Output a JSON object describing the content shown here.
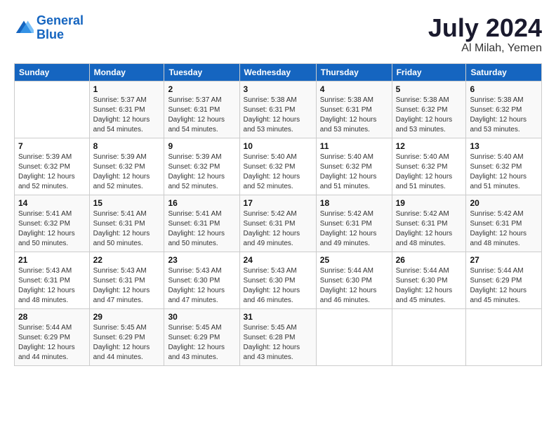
{
  "logo": {
    "line1": "General",
    "line2": "Blue"
  },
  "title": "July 2024",
  "subtitle": "Al Milah, Yemen",
  "days_header": [
    "Sunday",
    "Monday",
    "Tuesday",
    "Wednesday",
    "Thursday",
    "Friday",
    "Saturday"
  ],
  "weeks": [
    [
      {
        "day": "",
        "sunrise": "",
        "sunset": "",
        "daylight": ""
      },
      {
        "day": "1",
        "sunrise": "Sunrise: 5:37 AM",
        "sunset": "Sunset: 6:31 PM",
        "daylight": "Daylight: 12 hours and 54 minutes."
      },
      {
        "day": "2",
        "sunrise": "Sunrise: 5:37 AM",
        "sunset": "Sunset: 6:31 PM",
        "daylight": "Daylight: 12 hours and 54 minutes."
      },
      {
        "day": "3",
        "sunrise": "Sunrise: 5:38 AM",
        "sunset": "Sunset: 6:31 PM",
        "daylight": "Daylight: 12 hours and 53 minutes."
      },
      {
        "day": "4",
        "sunrise": "Sunrise: 5:38 AM",
        "sunset": "Sunset: 6:31 PM",
        "daylight": "Daylight: 12 hours and 53 minutes."
      },
      {
        "day": "5",
        "sunrise": "Sunrise: 5:38 AM",
        "sunset": "Sunset: 6:32 PM",
        "daylight": "Daylight: 12 hours and 53 minutes."
      },
      {
        "day": "6",
        "sunrise": "Sunrise: 5:38 AM",
        "sunset": "Sunset: 6:32 PM",
        "daylight": "Daylight: 12 hours and 53 minutes."
      }
    ],
    [
      {
        "day": "7",
        "sunrise": "Sunrise: 5:39 AM",
        "sunset": "Sunset: 6:32 PM",
        "daylight": "Daylight: 12 hours and 52 minutes."
      },
      {
        "day": "8",
        "sunrise": "Sunrise: 5:39 AM",
        "sunset": "Sunset: 6:32 PM",
        "daylight": "Daylight: 12 hours and 52 minutes."
      },
      {
        "day": "9",
        "sunrise": "Sunrise: 5:39 AM",
        "sunset": "Sunset: 6:32 PM",
        "daylight": "Daylight: 12 hours and 52 minutes."
      },
      {
        "day": "10",
        "sunrise": "Sunrise: 5:40 AM",
        "sunset": "Sunset: 6:32 PM",
        "daylight": "Daylight: 12 hours and 52 minutes."
      },
      {
        "day": "11",
        "sunrise": "Sunrise: 5:40 AM",
        "sunset": "Sunset: 6:32 PM",
        "daylight": "Daylight: 12 hours and 51 minutes."
      },
      {
        "day": "12",
        "sunrise": "Sunrise: 5:40 AM",
        "sunset": "Sunset: 6:32 PM",
        "daylight": "Daylight: 12 hours and 51 minutes."
      },
      {
        "day": "13",
        "sunrise": "Sunrise: 5:40 AM",
        "sunset": "Sunset: 6:32 PM",
        "daylight": "Daylight: 12 hours and 51 minutes."
      }
    ],
    [
      {
        "day": "14",
        "sunrise": "Sunrise: 5:41 AM",
        "sunset": "Sunset: 6:32 PM",
        "daylight": "Daylight: 12 hours and 50 minutes."
      },
      {
        "day": "15",
        "sunrise": "Sunrise: 5:41 AM",
        "sunset": "Sunset: 6:31 PM",
        "daylight": "Daylight: 12 hours and 50 minutes."
      },
      {
        "day": "16",
        "sunrise": "Sunrise: 5:41 AM",
        "sunset": "Sunset: 6:31 PM",
        "daylight": "Daylight: 12 hours and 50 minutes."
      },
      {
        "day": "17",
        "sunrise": "Sunrise: 5:42 AM",
        "sunset": "Sunset: 6:31 PM",
        "daylight": "Daylight: 12 hours and 49 minutes."
      },
      {
        "day": "18",
        "sunrise": "Sunrise: 5:42 AM",
        "sunset": "Sunset: 6:31 PM",
        "daylight": "Daylight: 12 hours and 49 minutes."
      },
      {
        "day": "19",
        "sunrise": "Sunrise: 5:42 AM",
        "sunset": "Sunset: 6:31 PM",
        "daylight": "Daylight: 12 hours and 48 minutes."
      },
      {
        "day": "20",
        "sunrise": "Sunrise: 5:42 AM",
        "sunset": "Sunset: 6:31 PM",
        "daylight": "Daylight: 12 hours and 48 minutes."
      }
    ],
    [
      {
        "day": "21",
        "sunrise": "Sunrise: 5:43 AM",
        "sunset": "Sunset: 6:31 PM",
        "daylight": "Daylight: 12 hours and 48 minutes."
      },
      {
        "day": "22",
        "sunrise": "Sunrise: 5:43 AM",
        "sunset": "Sunset: 6:31 PM",
        "daylight": "Daylight: 12 hours and 47 minutes."
      },
      {
        "day": "23",
        "sunrise": "Sunrise: 5:43 AM",
        "sunset": "Sunset: 6:30 PM",
        "daylight": "Daylight: 12 hours and 47 minutes."
      },
      {
        "day": "24",
        "sunrise": "Sunrise: 5:43 AM",
        "sunset": "Sunset: 6:30 PM",
        "daylight": "Daylight: 12 hours and 46 minutes."
      },
      {
        "day": "25",
        "sunrise": "Sunrise: 5:44 AM",
        "sunset": "Sunset: 6:30 PM",
        "daylight": "Daylight: 12 hours and 46 minutes."
      },
      {
        "day": "26",
        "sunrise": "Sunrise: 5:44 AM",
        "sunset": "Sunset: 6:30 PM",
        "daylight": "Daylight: 12 hours and 45 minutes."
      },
      {
        "day": "27",
        "sunrise": "Sunrise: 5:44 AM",
        "sunset": "Sunset: 6:29 PM",
        "daylight": "Daylight: 12 hours and 45 minutes."
      }
    ],
    [
      {
        "day": "28",
        "sunrise": "Sunrise: 5:44 AM",
        "sunset": "Sunset: 6:29 PM",
        "daylight": "Daylight: 12 hours and 44 minutes."
      },
      {
        "day": "29",
        "sunrise": "Sunrise: 5:45 AM",
        "sunset": "Sunset: 6:29 PM",
        "daylight": "Daylight: 12 hours and 44 minutes."
      },
      {
        "day": "30",
        "sunrise": "Sunrise: 5:45 AM",
        "sunset": "Sunset: 6:29 PM",
        "daylight": "Daylight: 12 hours and 43 minutes."
      },
      {
        "day": "31",
        "sunrise": "Sunrise: 5:45 AM",
        "sunset": "Sunset: 6:28 PM",
        "daylight": "Daylight: 12 hours and 43 minutes."
      },
      {
        "day": "",
        "sunrise": "",
        "sunset": "",
        "daylight": ""
      },
      {
        "day": "",
        "sunrise": "",
        "sunset": "",
        "daylight": ""
      },
      {
        "day": "",
        "sunrise": "",
        "sunset": "",
        "daylight": ""
      }
    ]
  ]
}
